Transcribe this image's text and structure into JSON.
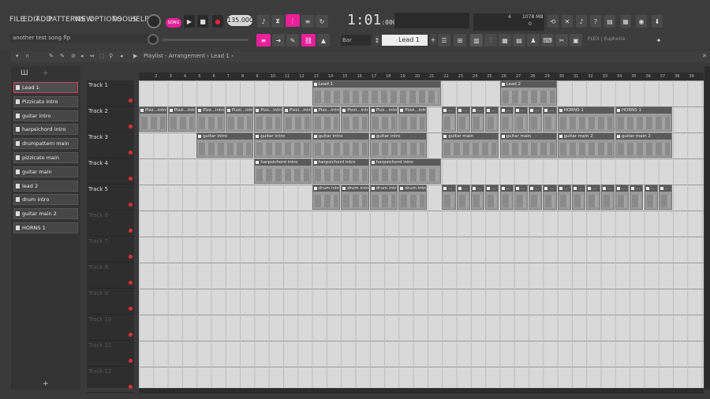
{
  "menu": [
    "FILE",
    "EDIT",
    "ADD",
    "PATTERNS",
    "VIEW",
    "OPTIONS",
    "TOOLS",
    "HELP"
  ],
  "transport": {
    "mode": "SONG",
    "tempo": "135.000",
    "time": "1:01",
    "time_sub": ":000"
  },
  "memory": {
    "cpu": "4",
    "mem": "1078 MB",
    "poly": "0"
  },
  "hint_text": "another test song flp",
  "snap": "Bar",
  "pattern": "Lead 1",
  "plugin": "FLEX | Euphoria",
  "playlist": {
    "title": "Playlist - Arrangement › Lead 1 ›"
  },
  "browser": [
    "Lead 1",
    "Pizzicato intro",
    "guitar intro",
    "harpsichord intro",
    "drumpattern main",
    "pizzicato main",
    "guitar main",
    "lead 2",
    "drum intro",
    "guitar main 2",
    "HORNS 1"
  ],
  "tracks": [
    "Track 1",
    "Track 2",
    "Track 3",
    "Track 4",
    "Track 5",
    "Track 6",
    "Track 7",
    "Track 8",
    "Track 9",
    "Track 10",
    "Track 11",
    "Track 12"
  ],
  "ruler": [
    "2",
    "3",
    "4",
    "5",
    "6",
    "7",
    "8",
    "9",
    "10",
    "11",
    "12",
    "13",
    "14",
    "15",
    "16",
    "17",
    "18",
    "19",
    "20",
    "21",
    "22",
    "23",
    "24",
    "25",
    "26",
    "27",
    "28",
    "29",
    "30",
    "31",
    "32",
    "33",
    "34",
    "35",
    "36",
    "37",
    "38",
    "39"
  ],
  "clips": [
    {
      "t": 0,
      "b": 13,
      "l": 9,
      "n": "Lead 1"
    },
    {
      "t": 0,
      "b": 26,
      "l": 4,
      "n": "Lead 2"
    },
    {
      "t": 1,
      "b": 1,
      "l": 2,
      "n": "Pizz...intro"
    },
    {
      "t": 1,
      "b": 3,
      "l": 2,
      "n": "Pizzi...intro"
    },
    {
      "t": 1,
      "b": 5,
      "l": 2,
      "n": "Pizz...intro"
    },
    {
      "t": 1,
      "b": 7,
      "l": 2,
      "n": "Pizzi...intro"
    },
    {
      "t": 1,
      "b": 9,
      "l": 2,
      "n": "Pizz...intro"
    },
    {
      "t": 1,
      "b": 11,
      "l": 2,
      "n": "Pizzi...intro"
    },
    {
      "t": 1,
      "b": 13,
      "l": 2,
      "n": "Pizz...intro"
    },
    {
      "t": 1,
      "b": 15,
      "l": 2,
      "n": "Pizzi...intro"
    },
    {
      "t": 1,
      "b": 17,
      "l": 2,
      "n": "Pizz...intro"
    },
    {
      "t": 1,
      "b": 19,
      "l": 2,
      "n": "Pizzi...intro"
    },
    {
      "t": 1,
      "b": 22,
      "l": 1,
      "n": "..."
    },
    {
      "t": 1,
      "b": 23,
      "l": 1,
      "n": "..."
    },
    {
      "t": 1,
      "b": 24,
      "l": 1,
      "n": "..."
    },
    {
      "t": 1,
      "b": 25,
      "l": 1,
      "n": "..."
    },
    {
      "t": 1,
      "b": 26,
      "l": 1,
      "n": "..."
    },
    {
      "t": 1,
      "b": 27,
      "l": 1,
      "n": "..."
    },
    {
      "t": 1,
      "b": 28,
      "l": 1,
      "n": "..."
    },
    {
      "t": 1,
      "b": 29,
      "l": 1,
      "n": "..."
    },
    {
      "t": 1,
      "b": 30,
      "l": 4,
      "n": "HORNS 1"
    },
    {
      "t": 1,
      "b": 34,
      "l": 4,
      "n": "HORNS 1"
    },
    {
      "t": 2,
      "b": 5,
      "l": 4,
      "n": "guitar intro"
    },
    {
      "t": 2,
      "b": 9,
      "l": 4,
      "n": "guitar intro"
    },
    {
      "t": 2,
      "b": 13,
      "l": 4,
      "n": "guitar intro"
    },
    {
      "t": 2,
      "b": 17,
      "l": 4,
      "n": "guitar intro"
    },
    {
      "t": 2,
      "b": 22,
      "l": 4,
      "n": "guitar main"
    },
    {
      "t": 2,
      "b": 26,
      "l": 4,
      "n": "guitar main"
    },
    {
      "t": 2,
      "b": 30,
      "l": 4,
      "n": "guitar main 2"
    },
    {
      "t": 2,
      "b": 34,
      "l": 4,
      "n": "guitar main 2"
    },
    {
      "t": 3,
      "b": 9,
      "l": 4,
      "n": "harpsichord intro"
    },
    {
      "t": 3,
      "b": 13,
      "l": 4,
      "n": "harpsichord intro"
    },
    {
      "t": 3,
      "b": 17,
      "l": 5,
      "n": "harpsichord intro"
    },
    {
      "t": 4,
      "b": 13,
      "l": 2,
      "n": "drum intro"
    },
    {
      "t": 4,
      "b": 15,
      "l": 2,
      "n": "drum intro"
    },
    {
      "t": 4,
      "b": 17,
      "l": 2,
      "n": "drum intro"
    },
    {
      "t": 4,
      "b": 19,
      "l": 2,
      "n": "drum intro"
    },
    {
      "t": 4,
      "b": 22,
      "l": 1,
      "n": "..."
    },
    {
      "t": 4,
      "b": 23,
      "l": 1,
      "n": "..."
    },
    {
      "t": 4,
      "b": 24,
      "l": 1,
      "n": "..."
    },
    {
      "t": 4,
      "b": 25,
      "l": 1,
      "n": "..."
    },
    {
      "t": 4,
      "b": 26,
      "l": 1,
      "n": "..."
    },
    {
      "t": 4,
      "b": 27,
      "l": 1,
      "n": "..."
    },
    {
      "t": 4,
      "b": 28,
      "l": 1,
      "n": "..."
    },
    {
      "t": 4,
      "b": 29,
      "l": 1,
      "n": "..."
    },
    {
      "t": 4,
      "b": 30,
      "l": 1,
      "n": "..."
    },
    {
      "t": 4,
      "b": 31,
      "l": 1,
      "n": "..."
    },
    {
      "t": 4,
      "b": 32,
      "l": 1,
      "n": "..."
    },
    {
      "t": 4,
      "b": 33,
      "l": 1,
      "n": "..."
    },
    {
      "t": 4,
      "b": 34,
      "l": 1,
      "n": "..."
    },
    {
      "t": 4,
      "b": 35,
      "l": 1,
      "n": "..."
    },
    {
      "t": 4,
      "b": 36,
      "l": 1,
      "n": "..."
    },
    {
      "t": 4,
      "b": 37,
      "l": 1,
      "n": "..."
    }
  ]
}
